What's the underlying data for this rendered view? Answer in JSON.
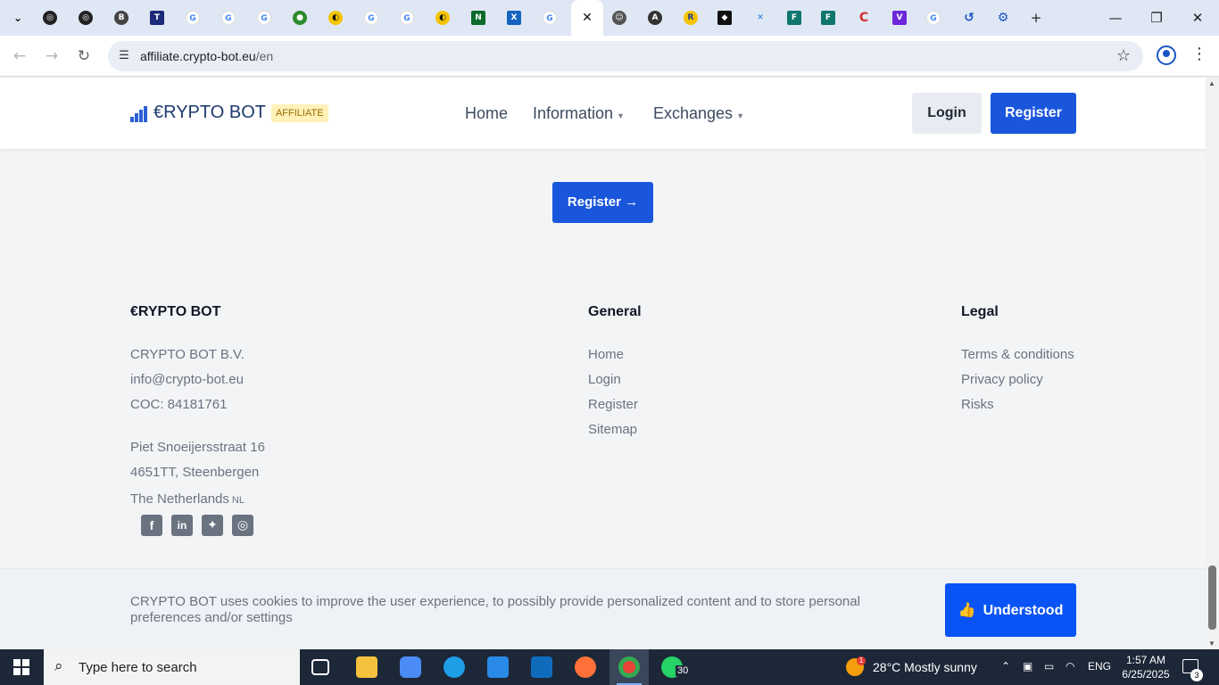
{
  "browser": {
    "tab_icons": [
      "openai-icon",
      "openai-icon",
      "bing-icon",
      "ttp-icon",
      "google-icon",
      "google-icon",
      "google-icon",
      "globe-icon",
      "logo-icon",
      "google-icon",
      "google-icon",
      "logo-icon",
      "nnn-icon",
      "xf-icon",
      "google-icon",
      "close-tab-icon",
      "avatar-icon",
      "a-icon",
      "r-icon",
      "s-icon",
      "x-icon",
      "f-icon",
      "f-icon",
      "c-icon",
      "v-icon",
      "google-icon",
      "history-icon",
      "settings-icon"
    ],
    "url_host": "affiliate.crypto-bot.eu",
    "url_path": "/en"
  },
  "header": {
    "logo_text": "€RYPTO BOT",
    "logo_badge": "AFFILIATE",
    "nav": [
      "Home",
      "Information",
      "Exchanges"
    ],
    "login_label": "Login",
    "register_label": "Register"
  },
  "cta": {
    "register_label": "Register →"
  },
  "footer": {
    "brand": {
      "title": "€RYPTO BOT",
      "company": "CRYPTO BOT B.V.",
      "email": "info@crypto-bot.eu",
      "coc": "COC: 84181761",
      "street": "Piet Snoeijersstraat 16",
      "city": "4651TT, Steenbergen",
      "country": "The Netherlands",
      "country_code": "NL"
    },
    "general": {
      "title": "General",
      "links": [
        "Home",
        "Login",
        "Register",
        "Sitemap"
      ]
    },
    "legal": {
      "title": "Legal",
      "links": [
        "Terms & conditions",
        "Privacy policy",
        "Risks"
      ]
    },
    "social": [
      "facebook-icon",
      "linkedin-icon",
      "twitter-icon",
      "instagram-icon"
    ]
  },
  "cookie": {
    "text": "CRYPTO BOT uses cookies to improve the user experience, to possibly provide personalized content and to store personal preferences and/or settings",
    "button_label": "Understood"
  },
  "taskbar": {
    "search_placeholder": "Type here to search",
    "whatsapp_badge": "30",
    "weather": "28°C  Mostly sunny",
    "weather_badge": "1",
    "language": "ENG",
    "time": "1:57 AM",
    "date": "6/25/2025",
    "notifications": "3"
  },
  "colors": {
    "brand_blue": "#1a56db",
    "cookie_button": "#0a54f5",
    "taskbar": "#1c2738"
  }
}
